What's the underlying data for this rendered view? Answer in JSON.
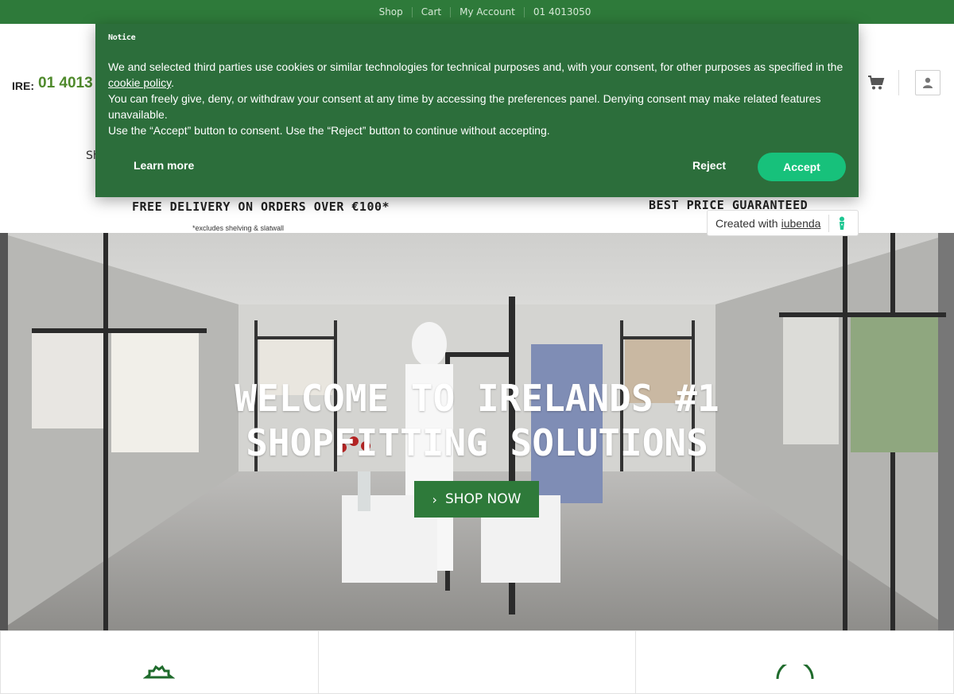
{
  "topbar": {
    "links": [
      "Shop",
      "Cart",
      "My Account",
      "01 4013050"
    ]
  },
  "header": {
    "phone_label": "IRE:",
    "phone_number": "01 4013",
    "nav_peek_left": "Sh",
    "nav_peek_right": "`",
    "usp_delivery": "FREE DELIVERY ON ORDERS OVER €100*",
    "usp_delivery_note": "*excludes shelving & slatwall",
    "usp_price": "BEST PRICE GUARANTEED"
  },
  "hero": {
    "title": "WELCOME TO IRELANDS #1 SHOPFITTING SOLUTIONS",
    "cta_label": "SHOP NOW"
  },
  "cookie_banner": {
    "heading": "Notice",
    "text_1": "We and selected third parties use cookies or similar technologies for technical purposes and, with your consent, for other purposes as specified in the",
    "link_text": "cookie policy",
    "text_1_end": ".",
    "text_2": "You can freely give, deny, or withdraw your consent at any time by accessing the preferences panel. Denying consent may make related features unavailable.",
    "text_3": "Use the “Accept” button to consent. Use the “Reject” button to continue without accepting.",
    "learn_more": "Learn more",
    "reject": "Reject",
    "accept": "Accept"
  },
  "iubenda": {
    "prefix": "Created with",
    "brand": "iubenda"
  },
  "icons": {
    "cart": "shopping-cart-icon",
    "account": "user-icon",
    "cta": "chevron-right-icon",
    "iubenda": "iubenda-logo-icon"
  },
  "colors": {
    "brand_green": "#2e7a3a",
    "banner_green": "#2c6e3b",
    "accept_button": "#17c17b",
    "phone_green": "#4f8a2c"
  }
}
